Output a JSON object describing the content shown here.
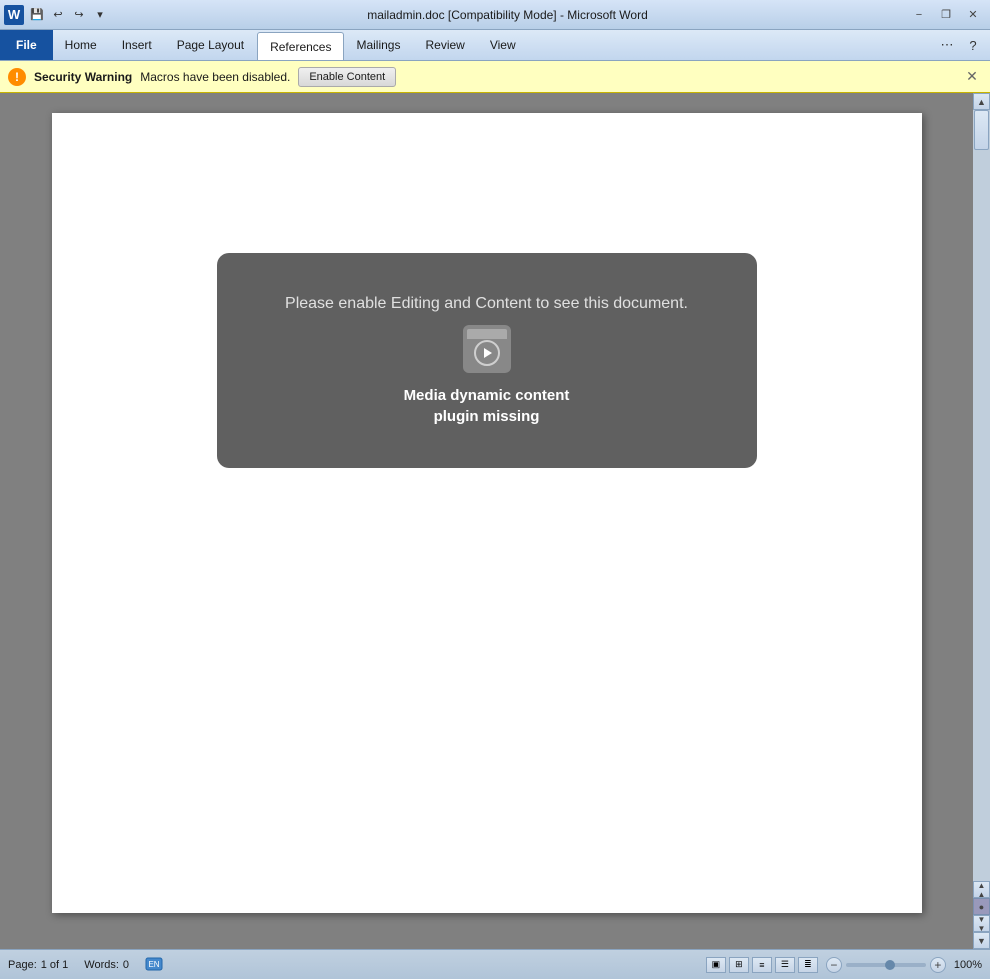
{
  "titlebar": {
    "title": "mailadmin.doc [Compatibility Mode] - Microsoft Word",
    "word_label": "W",
    "minimize": "−",
    "restore": "❐",
    "close": "✕"
  },
  "ribbon": {
    "tabs": [
      {
        "id": "file",
        "label": "File",
        "active": false,
        "is_file": true
      },
      {
        "id": "home",
        "label": "Home",
        "active": false
      },
      {
        "id": "insert",
        "label": "Insert",
        "active": false
      },
      {
        "id": "page-layout",
        "label": "Page Layout",
        "active": false
      },
      {
        "id": "references",
        "label": "References",
        "active": true
      },
      {
        "id": "mailings",
        "label": "Mailings",
        "active": false
      },
      {
        "id": "review",
        "label": "Review",
        "active": false
      },
      {
        "id": "view",
        "label": "View",
        "active": false
      }
    ]
  },
  "security": {
    "icon": "!",
    "title": "Security Warning",
    "message": "Macros have been disabled.",
    "button_label": "Enable Content",
    "close": "✕"
  },
  "document": {
    "media_box": {
      "prompt": "Please enable Editing and Content to see this document.",
      "title_line1": "Media dynamic content",
      "title_line2": "plugin missing"
    }
  },
  "statusbar": {
    "page_label": "Page:",
    "page_value": "1 of 1",
    "words_label": "Words:",
    "words_value": "0",
    "zoom_value": "100%"
  }
}
